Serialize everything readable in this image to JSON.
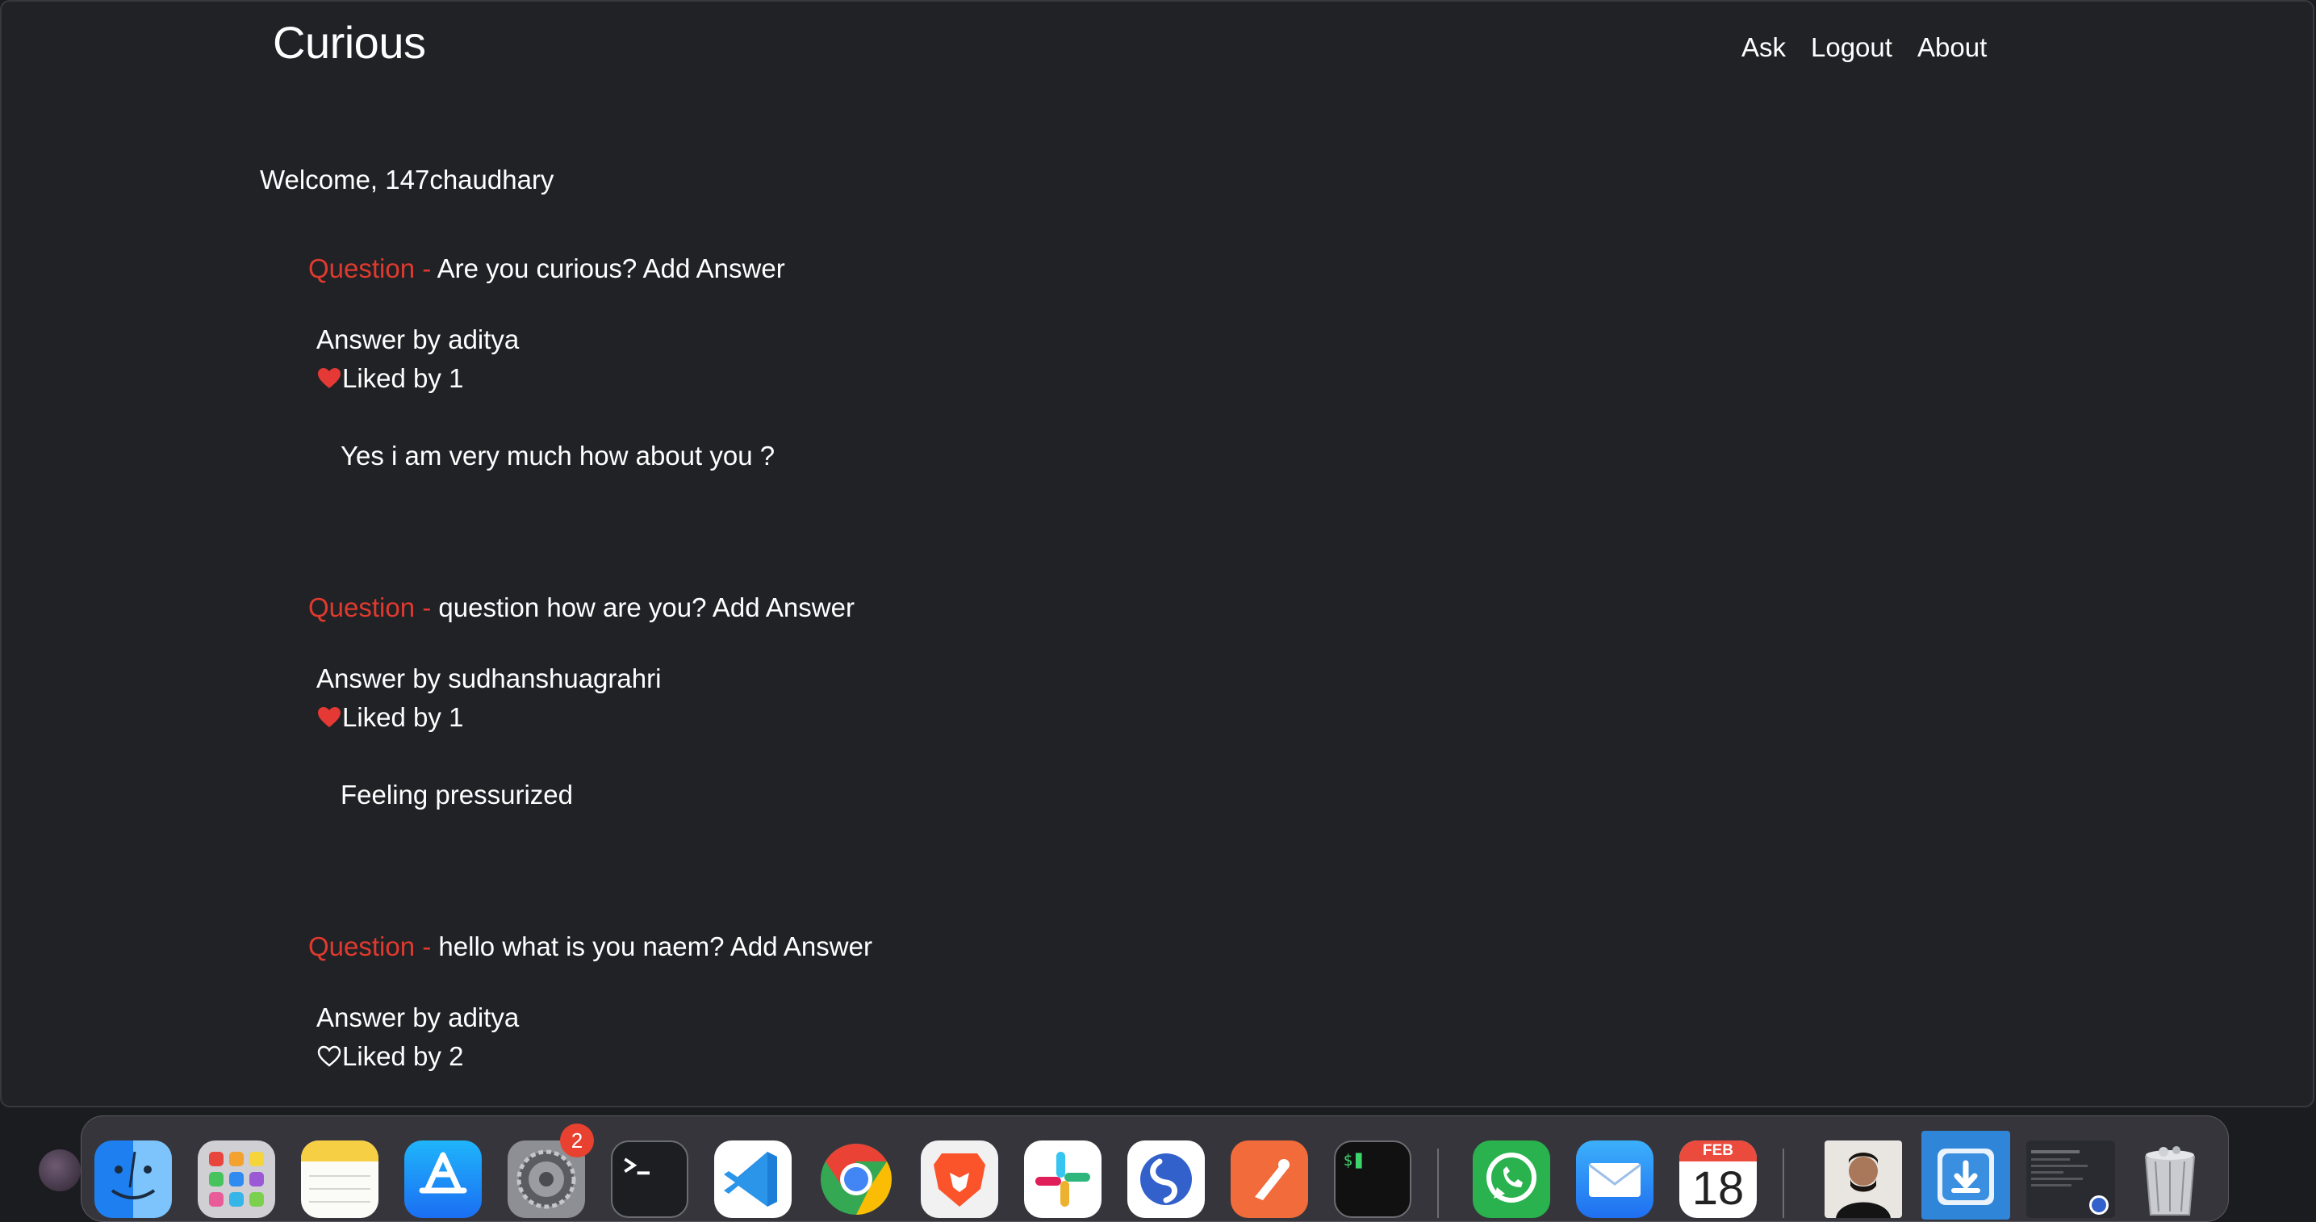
{
  "app": {
    "brand": "Curious"
  },
  "nav": {
    "ask": "Ask",
    "logout": "Logout",
    "about": "About"
  },
  "welcome": "Welcome, 147chaudhary",
  "questions": [
    {
      "prefix": "Question -",
      "text": "Are you curious?",
      "add_answer": "Add Answer",
      "answer_by": "Answer by aditya",
      "liked": true,
      "likes_label": "Liked by 1",
      "answer": "Yes i am very much how about you ?"
    },
    {
      "prefix": "Question -",
      "text": "question how are you?",
      "add_answer": "Add Answer",
      "answer_by": "Answer by sudhanshuagrahri",
      "liked": true,
      "likes_label": "Liked by 1",
      "answer": "Feeling pressurized"
    },
    {
      "prefix": "Question -",
      "text": "hello what is you naem?",
      "add_answer": "Add Answer",
      "answer_by": "Answer by aditya",
      "liked": false,
      "likes_label": "Liked by 2",
      "answer": ""
    }
  ],
  "dock": {
    "items": [
      "finder-icon",
      "launchpad-icon",
      "notes-icon",
      "app-store-icon",
      "system-settings-icon",
      "terminal-icon",
      "vscode-icon",
      "chrome-icon",
      "brave-icon",
      "slack-icon",
      "simplenote-icon",
      "postman-icon",
      "iterm-icon",
      "whatsapp-icon",
      "mail-icon",
      "calendar-icon",
      "profile-photo",
      "downloads-folder",
      "recent-window",
      "trash-icon"
    ],
    "settings_badge": "2",
    "calendar_month": "FEB",
    "calendar_day": "18"
  }
}
